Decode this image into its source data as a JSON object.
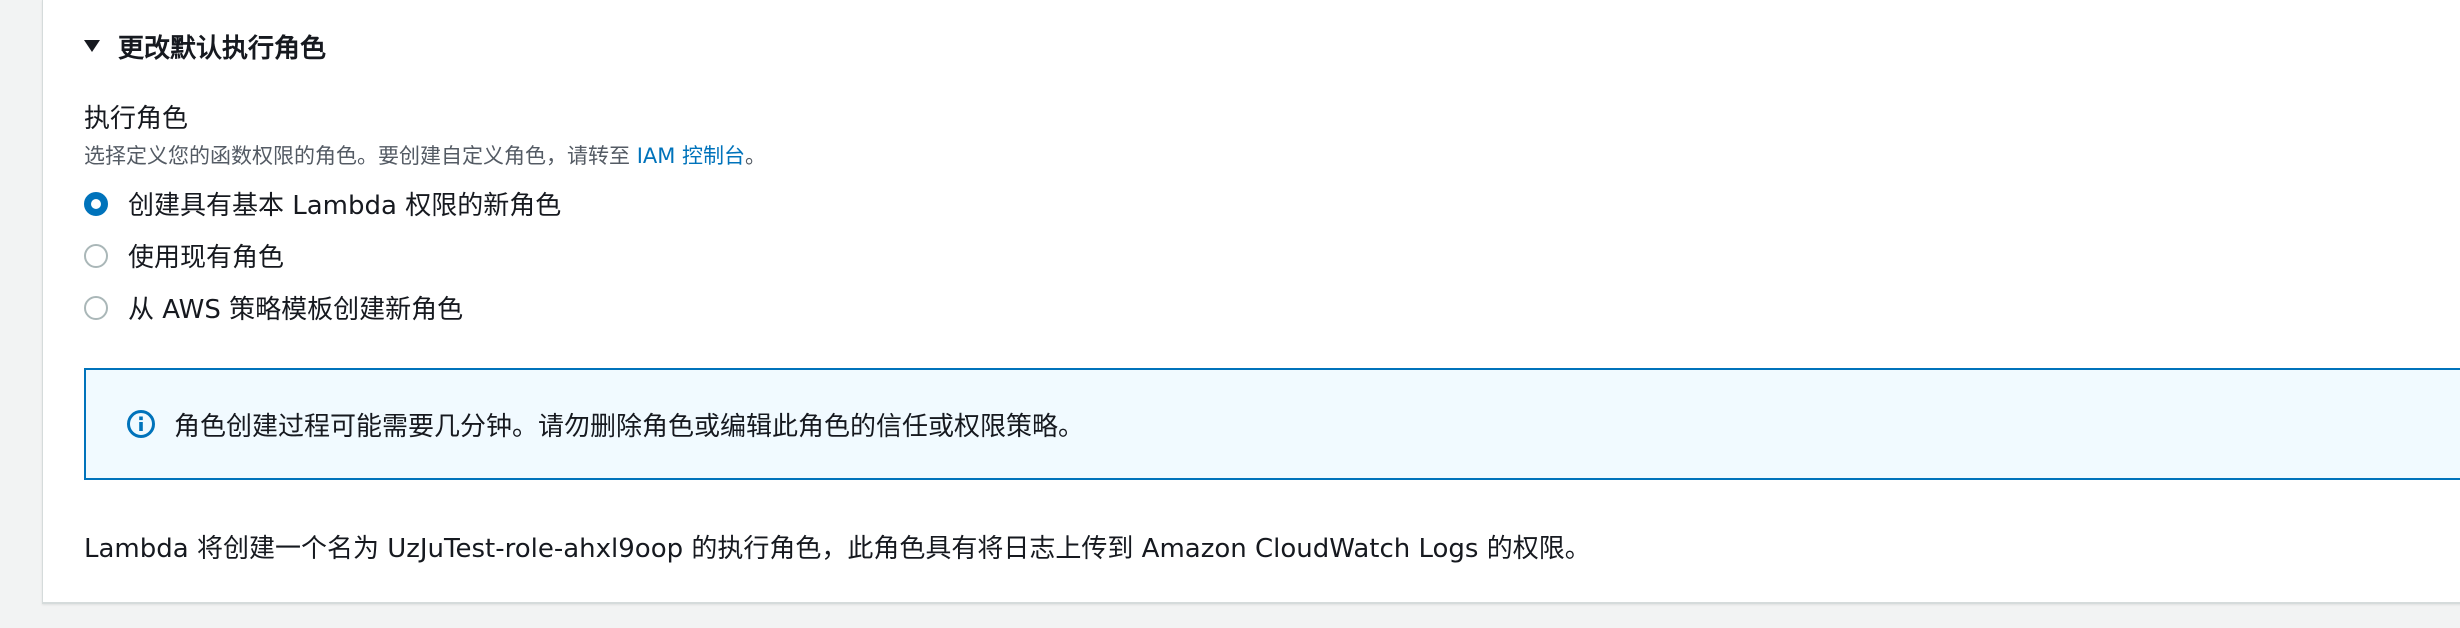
{
  "section": {
    "title": "更改默认执行角色"
  },
  "field": {
    "label": "执行角色",
    "description_prefix": "选择定义您的函数权限的角色。要创建自定义角色，请转至",
    "link_text": "IAM 控制台",
    "description_suffix": "。"
  },
  "radios": [
    {
      "label": "创建具有基本 Lambda 权限的新角色",
      "checked": true
    },
    {
      "label": "使用现有角色",
      "checked": false
    },
    {
      "label": "从 AWS 策略模板创建新角色",
      "checked": false
    }
  ],
  "info": {
    "text": "角色创建过程可能需要几分钟。请勿删除角色或编辑此角色的信任或权限策略。"
  },
  "footer": {
    "text": "Lambda 将创建一个名为 UzJuTest-role-ahxl9oop 的执行角色，此角色具有将日志上传到 Amazon CloudWatch Logs 的权限。"
  },
  "colors": {
    "accent": "#0073bb",
    "info_background": "#f1faff",
    "page_background": "#f2f3f3"
  }
}
